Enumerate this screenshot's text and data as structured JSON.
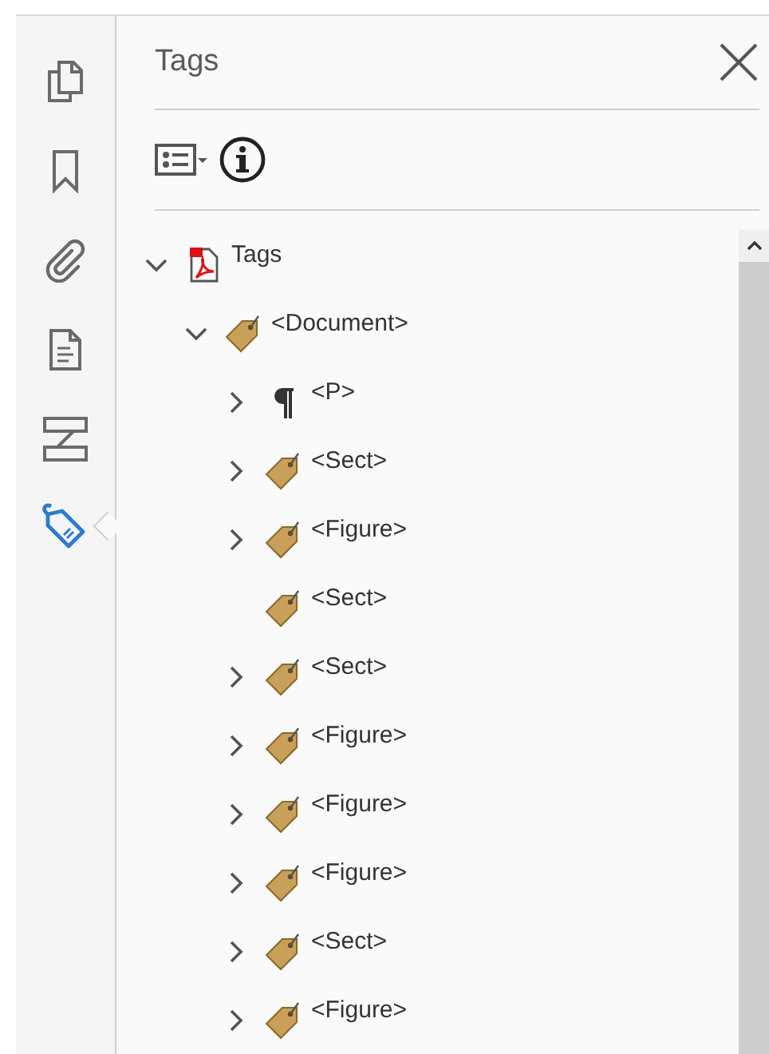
{
  "rail": [
    {
      "kind": "pages",
      "selected": false
    },
    {
      "kind": "bookmark",
      "selected": false
    },
    {
      "kind": "attachment",
      "selected": false
    },
    {
      "kind": "document",
      "selected": false
    },
    {
      "kind": "structure",
      "selected": false
    },
    {
      "kind": "tag",
      "selected": true
    }
  ],
  "panel": {
    "title": "Tags"
  },
  "tree": [
    {
      "kind": "pdf",
      "label": "Tags",
      "expanded": true,
      "children": [
        {
          "kind": "tag",
          "label": "<Document>",
          "expanded": true,
          "children": [
            {
              "kind": "paragraph",
              "label": "<P>",
              "expanded": false
            },
            {
              "kind": "tag",
              "label": "<Sect>",
              "expanded": false
            },
            {
              "kind": "tag",
              "label": "<Figure>",
              "expanded": false
            },
            {
              "kind": "tag",
              "label": "<Sect>"
            },
            {
              "kind": "tag",
              "label": "<Sect>",
              "expanded": false
            },
            {
              "kind": "tag",
              "label": "<Figure>",
              "expanded": false
            },
            {
              "kind": "tag",
              "label": "<Figure>",
              "expanded": false
            },
            {
              "kind": "tag",
              "label": "<Figure>",
              "expanded": false
            },
            {
              "kind": "tag",
              "label": "<Sect>",
              "expanded": false
            },
            {
              "kind": "tag",
              "label": "<Figure>",
              "expanded": false
            }
          ]
        }
      ]
    }
  ]
}
